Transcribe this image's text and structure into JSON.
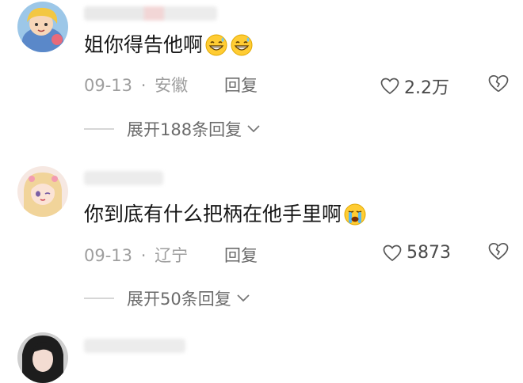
{
  "comments": [
    {
      "text": "姐你得告他啊",
      "emoji": [
        "grinning-sweat-emoji",
        "grinning-sweat-emoji"
      ],
      "date": "09-13",
      "separator": "·",
      "location": "安徽",
      "reply_label": "回复",
      "likes": "2.2万",
      "expand_label": "展开188条回复"
    },
    {
      "text": "你到底有什么把柄在他手里啊",
      "emoji": [
        "crying-emoji"
      ],
      "date": "09-13",
      "separator": "·",
      "location": "辽宁",
      "reply_label": "回复",
      "likes": "5873",
      "expand_label": "展开50条回复"
    }
  ],
  "colors": {
    "text": "#161616",
    "meta": "#9e9e9e",
    "secondary": "#6b6b6b",
    "divider": "#d6d6d6"
  }
}
